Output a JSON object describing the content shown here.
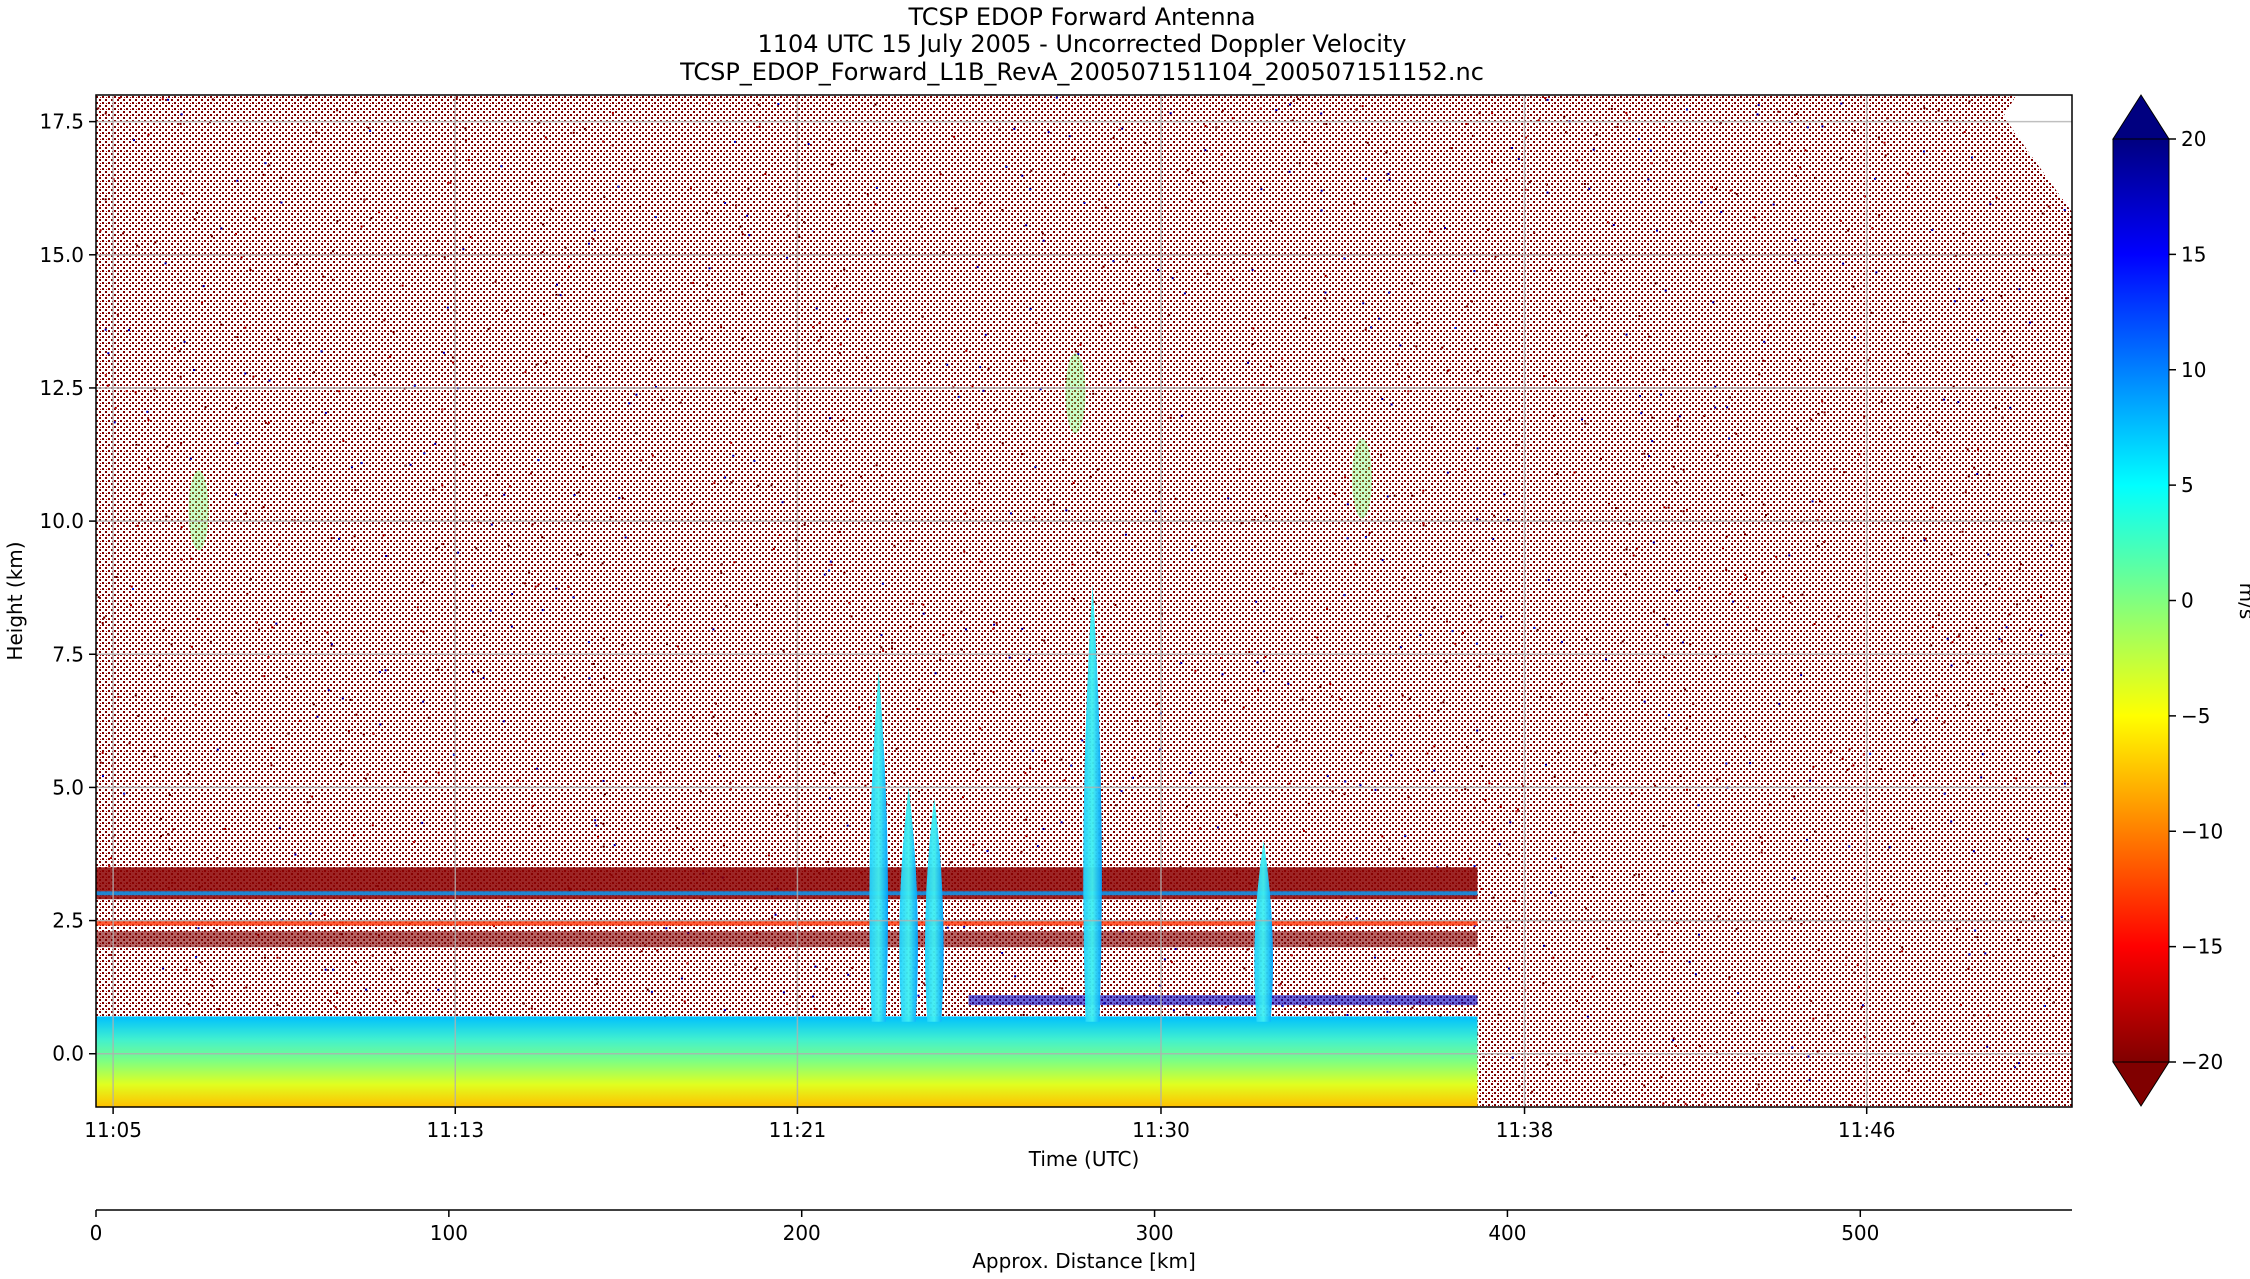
{
  "chart_data": {
    "type": "heatmap",
    "title": [
      "TCSP EDOP Forward Antenna",
      "1104 UTC 15 July 2005 - Uncorrected Doppler Velocity",
      "TCSP_EDOP_Forward_L1B_RevA_200507151104_200507151152.nc"
    ],
    "xlabel": "Time (UTC)",
    "ylabel": "Height (km)",
    "x_ticks": [
      "11:05",
      "11:13",
      "11:21",
      "11:30",
      "11:38",
      "11:46"
    ],
    "x_tick_minutes": [
      5,
      13,
      21,
      29.5,
      38,
      46
    ],
    "xlim_minutes": [
      4.6,
      50.8
    ],
    "y_ticks": [
      "0.0",
      "2.5",
      "5.0",
      "7.5",
      "10.0",
      "12.5",
      "15.0",
      "17.5"
    ],
    "y_tick_values": [
      0,
      2.5,
      5,
      7.5,
      10,
      12.5,
      15,
      17.5
    ],
    "ylim": [
      -1,
      18
    ],
    "grid": true,
    "secondary_x": {
      "label": "Approx. Distance [km]",
      "ticks": [
        "0",
        "100",
        "200",
        "300",
        "400",
        "500"
      ],
      "tick_values": [
        0,
        100,
        200,
        300,
        400,
        500
      ],
      "xlim": [
        0,
        560
      ]
    },
    "colorbar": {
      "label": "m/s",
      "ticks": [
        "20",
        "15",
        "10",
        "5",
        "0",
        "−5",
        "−10",
        "−15",
        "−20"
      ],
      "tick_values": [
        20,
        15,
        10,
        5,
        0,
        -5,
        -10,
        -15,
        -20
      ],
      "range": [
        -20,
        20
      ],
      "extend": "both",
      "colormap": "jet_reversed",
      "colors": [
        "#800000",
        "#ff0000",
        "#ff8000",
        "#ffff00",
        "#80ff80",
        "#00ffff",
        "#0080ff",
        "#0000ff",
        "#000080"
      ]
    },
    "features": {
      "noise_end_minutes": 36.9,
      "surface_band": {
        "bottom_km": -1,
        "top_km": 0.7,
        "velocity_ms": 3
      },
      "bright_band_km": [
        2.0,
        3.5
      ],
      "convective_cells": [
        {
          "center_minutes": 22.9,
          "top_km": 7.2,
          "velocity_ms": 8
        },
        {
          "center_minutes": 23.6,
          "top_km": 5.0,
          "velocity_ms": 8
        },
        {
          "center_minutes": 24.2,
          "top_km": 4.8,
          "velocity_ms": 7
        },
        {
          "center_minutes": 27.9,
          "top_km": 8.8,
          "velocity_ms": 6
        },
        {
          "center_minutes": 31.9,
          "top_km": 4.0,
          "velocity_ms": 4
        }
      ]
    }
  }
}
